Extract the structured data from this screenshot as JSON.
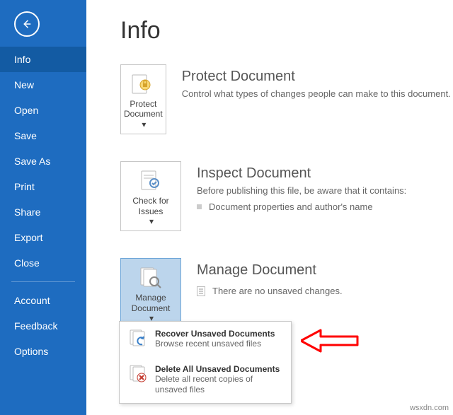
{
  "sidebar": {
    "items": [
      {
        "label": "Info"
      },
      {
        "label": "New"
      },
      {
        "label": "Open"
      },
      {
        "label": "Save"
      },
      {
        "label": "Save As"
      },
      {
        "label": "Print"
      },
      {
        "label": "Share"
      },
      {
        "label": "Export"
      },
      {
        "label": "Close"
      }
    ],
    "footer": [
      {
        "label": "Account"
      },
      {
        "label": "Feedback"
      },
      {
        "label": "Options"
      }
    ]
  },
  "page": {
    "title": "Info"
  },
  "protect": {
    "tile_label": "Protect Document",
    "title": "Protect Document",
    "desc": "Control what types of changes people can make to this document."
  },
  "inspect": {
    "tile_label": "Check for Issues",
    "title": "Inspect Document",
    "desc": "Before publishing this file, be aware that it contains:",
    "bullet1": "Document properties and author's name"
  },
  "manage": {
    "tile_label": "Manage Document",
    "title": "Manage Document",
    "note": "There are no unsaved changes."
  },
  "dropdown": {
    "recover_title": "Recover Unsaved Documents",
    "recover_sub": "Browse recent unsaved files",
    "delete_title": "Delete All Unsaved Documents",
    "delete_sub": "Delete all recent copies of unsaved files"
  },
  "watermark": "wsxdn.com",
  "caret": "▾"
}
